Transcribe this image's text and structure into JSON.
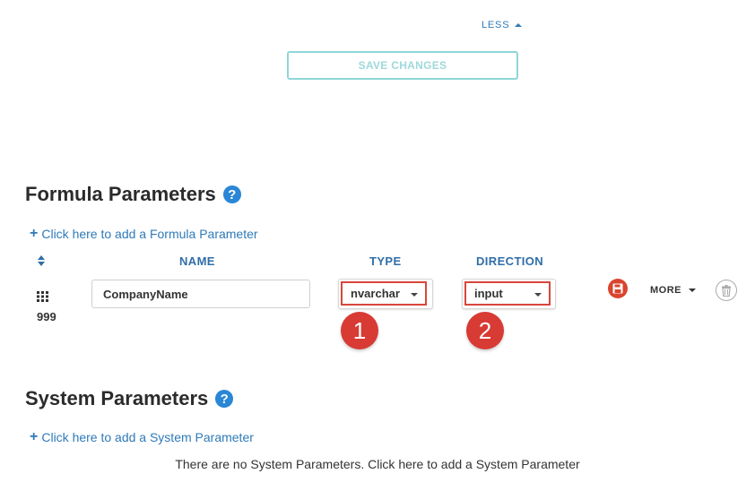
{
  "toggle": {
    "label": "LESS",
    "icon": "caret-up-icon"
  },
  "save_button": {
    "label": "SAVE CHANGES"
  },
  "formula": {
    "title": "Formula Parameters",
    "help_glyph": "?",
    "add_link": "Click here to add a Formula Parameter",
    "columns": {
      "name": "NAME",
      "type": "TYPE",
      "direction": "DIRECTION"
    },
    "row": {
      "order": "999",
      "name": "CompanyName",
      "type": "nvarchar",
      "direction": "input",
      "more_label": "MORE"
    },
    "callouts": [
      "1",
      "2"
    ]
  },
  "system": {
    "title": "System Parameters",
    "help_glyph": "?",
    "add_link": "Click here to add a System Parameter",
    "empty_text": "There are no System Parameters. Click here to add a System Parameter"
  },
  "colors": {
    "link": "#2f7ab8",
    "save_border": "#8fd6d8",
    "callout": "#d83b34",
    "highlight": "#d9463c",
    "help": "#2a86d6"
  }
}
